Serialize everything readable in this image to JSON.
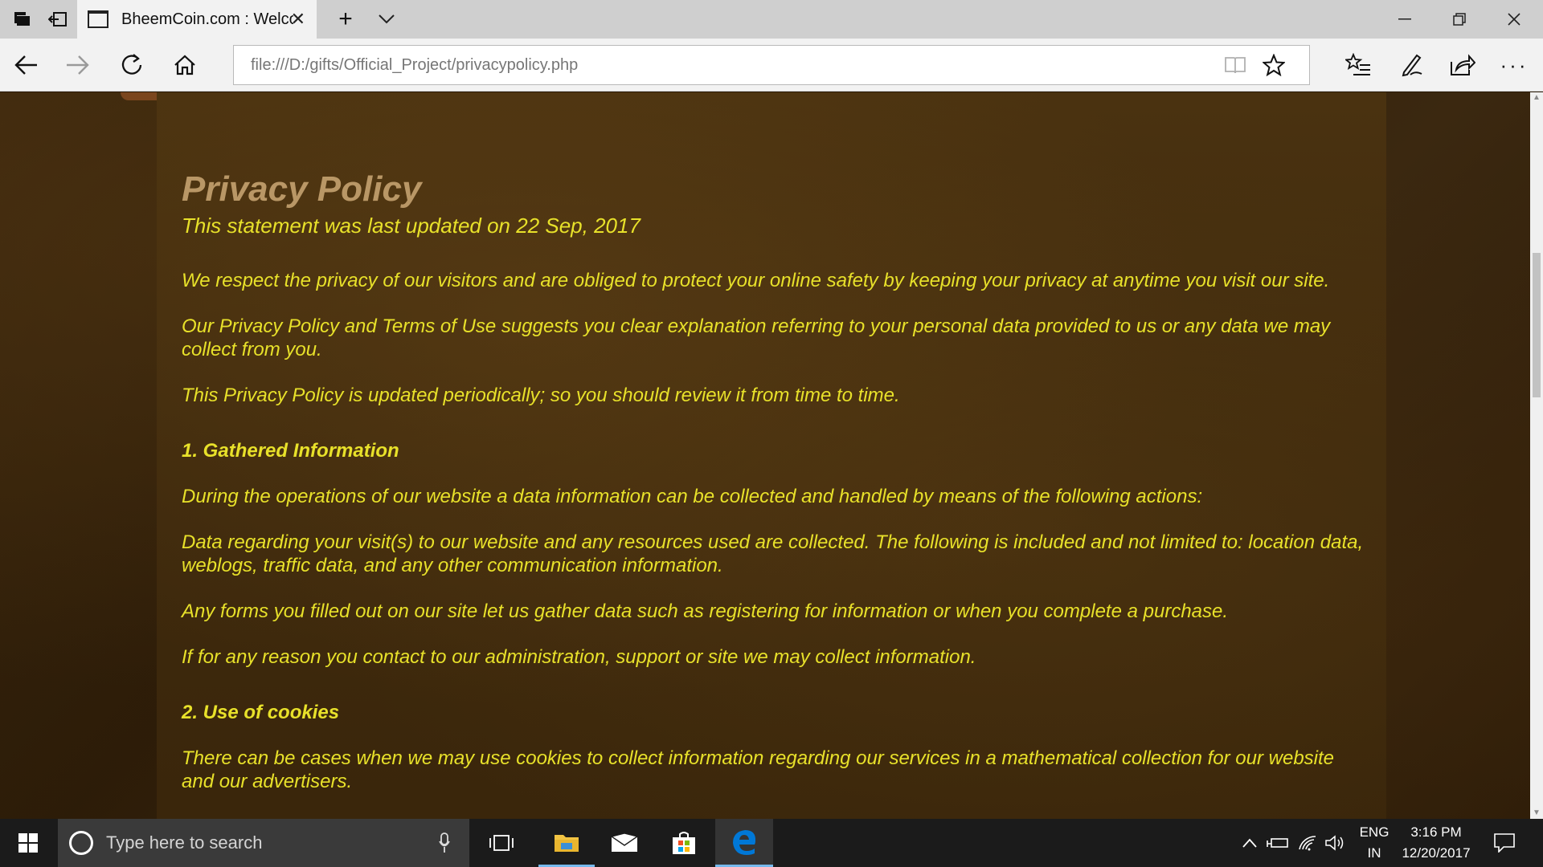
{
  "browser": {
    "tab": {
      "title": "BheemCoin.com : Welcome"
    },
    "address_bar": {
      "url": "file:///D:/gifts/Official_Project/privacypolicy.php"
    }
  },
  "page": {
    "title": "Privacy Policy",
    "updated": "This statement was last updated on 22 Sep, 2017",
    "intro": [
      "We respect the privacy of our visitors and are obliged to protect your online safety by keeping your privacy at anytime you visit our site.",
      "Our Privacy Policy and Terms of Use suggests you clear explanation referring to your personal data provided to us or any data we may collect from you.",
      "This Privacy Policy is updated periodically; so you should review it from time to time."
    ],
    "section1": {
      "heading": "1. Gathered Information",
      "paragraphs": [
        "During the operations of our website a data information can be collected and handled by means of the following actions:",
        "Data regarding your visit(s) to our website and any resources used are collected. The following is included and not limited to: location data, weblogs, traffic data, and any other communication information.",
        "Any forms you filled out on our site let us gather data such as registering for information or when you complete a purchase.",
        "If for any reason you contact to our administration, support or site we may collect information."
      ]
    },
    "section2": {
      "heading": "2. Use of cookies",
      "paragraphs": [
        "There can be cases when we may use cookies to collect information regarding our services in a mathematical collection for our website and our advertisers."
      ]
    }
  },
  "taskbar": {
    "search_placeholder": "Type here to search",
    "language": "ENG",
    "region": "IN",
    "time": "3:16 PM",
    "date": "12/20/2017"
  },
  "colors": {
    "body_text": "#e8e12a",
    "title_text": "#b99766",
    "taskbar_bg": "#1b1b1b",
    "edge_blue": "#0078d7"
  }
}
